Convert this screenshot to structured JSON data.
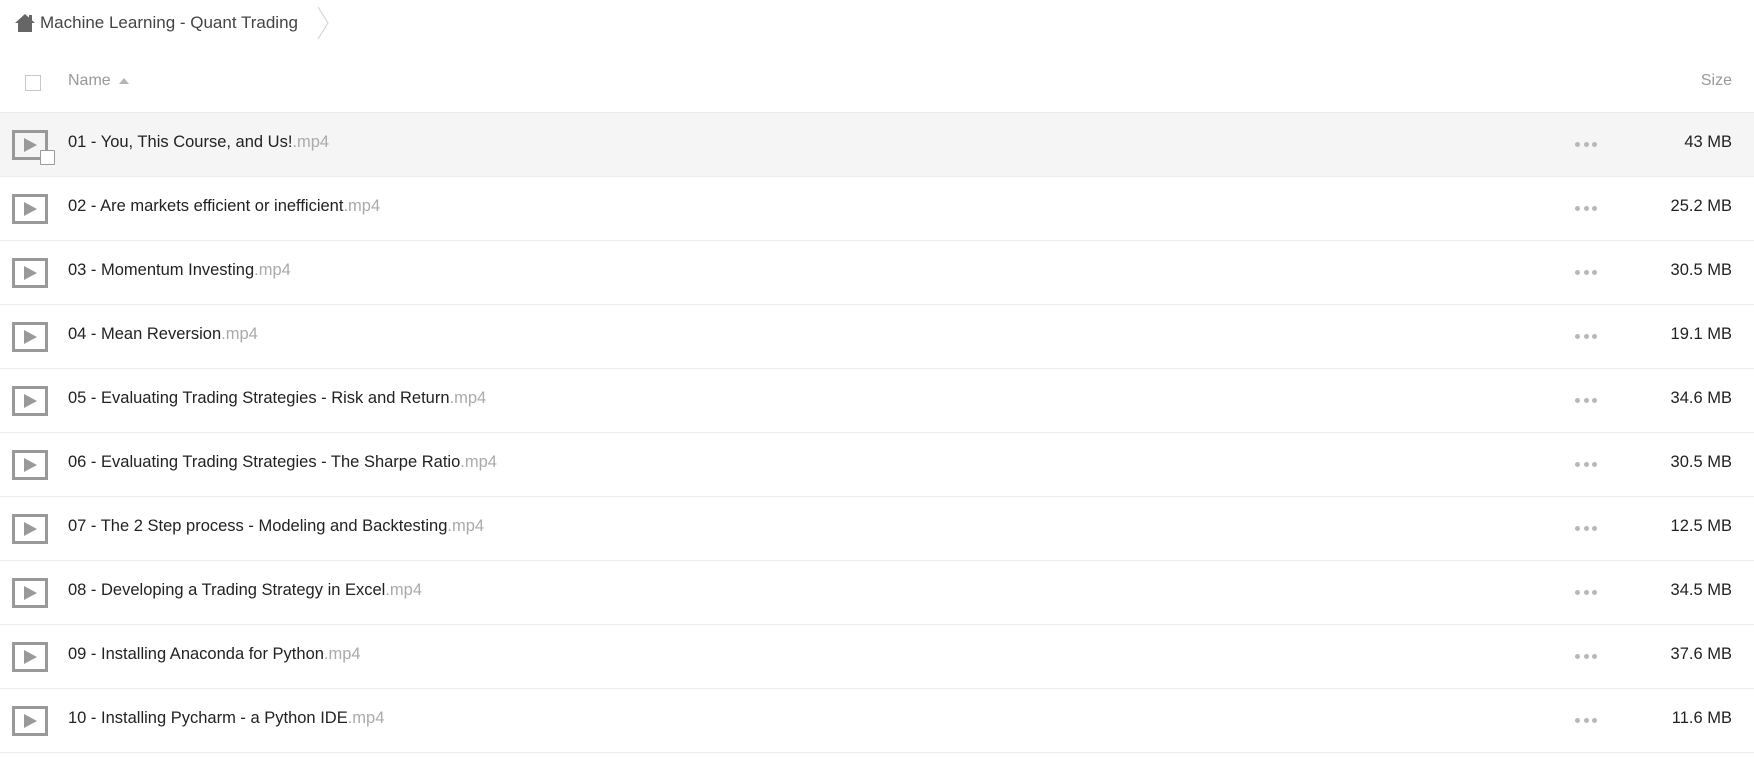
{
  "breadcrumb": {
    "home_icon": "home-icon",
    "label": "Machine Learning - Quant Trading",
    "separator_icon": "chevron-right-icon"
  },
  "header": {
    "name_label": "Name",
    "sort_icon": "sort-ascending-icon",
    "size_label": "Size"
  },
  "files": [
    {
      "name": "01 - You, This Course, and Us!",
      "ext": ".mp4",
      "size": "43 MB",
      "hover": true
    },
    {
      "name": "02 - Are markets efficient or inefficient",
      "ext": ".mp4",
      "size": "25.2 MB"
    },
    {
      "name": "03 - Momentum Investing",
      "ext": ".mp4",
      "size": "30.5 MB"
    },
    {
      "name": "04 - Mean Reversion",
      "ext": ".mp4",
      "size": "19.1 MB"
    },
    {
      "name": "05 - Evaluating Trading Strategies - Risk and Return",
      "ext": ".mp4",
      "size": "34.6 MB"
    },
    {
      "name": "06 - Evaluating Trading Strategies - The Sharpe Ratio",
      "ext": ".mp4",
      "size": "30.5 MB"
    },
    {
      "name": "07 - The 2 Step process - Modeling and Backtesting",
      "ext": ".mp4",
      "size": "12.5 MB"
    },
    {
      "name": "08 - Developing a Trading Strategy in Excel",
      "ext": ".mp4",
      "size": "34.5 MB"
    },
    {
      "name": "09 - Installing Anaconda for Python",
      "ext": ".mp4",
      "size": "37.6 MB"
    },
    {
      "name": "10 - Installing Pycharm - a Python IDE",
      "ext": ".mp4",
      "size": "11.6 MB"
    }
  ],
  "icons": {
    "file": "video-file-icon",
    "more": "more-options-icon"
  }
}
